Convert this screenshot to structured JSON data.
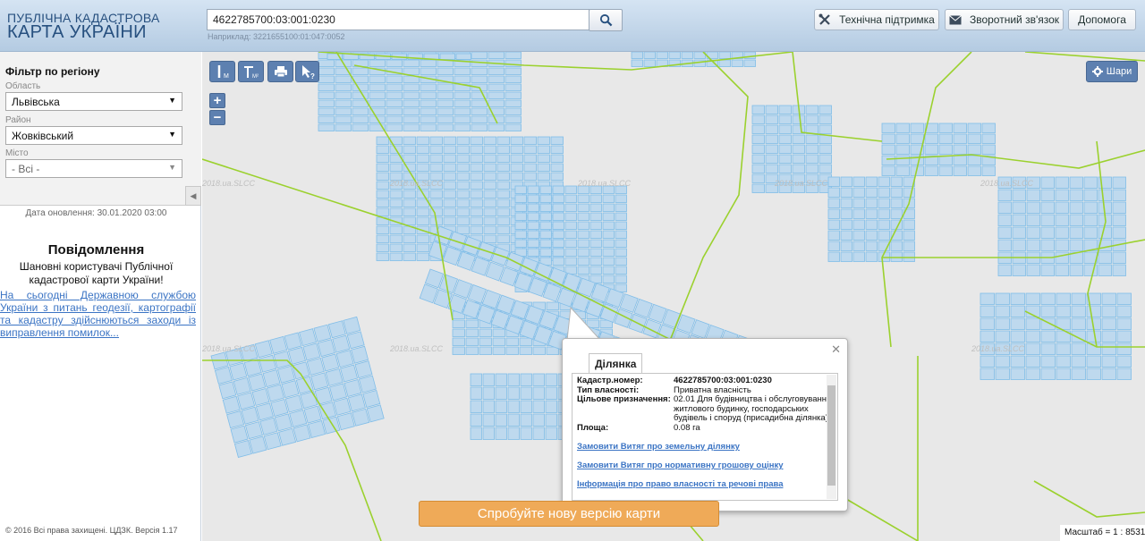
{
  "header": {
    "logo_line1": "ПУБЛІЧНА КАДАСТРОВА",
    "logo_line2": "КАРТА УКРАЇНИ",
    "search_value": "4622785700:03:001:0230",
    "search_example": "Наприклад: 3221655100:01:047:0052",
    "buttons": {
      "support": "Технічна підтримка",
      "feedback": "Зворотний зв'язок",
      "help": "Допомога"
    }
  },
  "sidebar": {
    "filter_title": "Фільтр по регіону",
    "oblast_label": "Область",
    "oblast_value": "Львівська",
    "rayon_label": "Район",
    "rayon_value": "Жовківський",
    "city_label": "Місто",
    "city_value": "- Всі -",
    "updated": "Дата оновлення: 30.01.2020 03:00",
    "notice_title": "Повідомлення",
    "notice_body": "Шановні користувачі Публічної кадастрової карти України!",
    "notice_link": "На сьогодні Державною службою України з питань геодезії, картографії та кадастру здійснюються заходи із виправлення помилок...",
    "copyright": "© 2016 Всі права захищені. ЦДЗК. Версія 1.17"
  },
  "map": {
    "tools": [
      "M",
      "M²"
    ],
    "zoom_in": "+",
    "zoom_out": "−",
    "layers_button": "Шари",
    "watermark": "2018.ua.SLCC",
    "scale": "Масштаб = 1 : 8531",
    "new_version_button": "Спробуйте нову версію карти",
    "colors": {
      "parcel_fill": "#bed9ee",
      "parcel_stroke": "#80bde8",
      "boundary": "#9bd12e",
      "background": "#e8e8e8"
    }
  },
  "popup": {
    "tab": "Ділянка",
    "fields": [
      {
        "label": "Кадастр.номер:",
        "value": "4622785700:03:001:0230"
      },
      {
        "label": "Тип власності:",
        "value": "Приватна власність"
      },
      {
        "label": "Цільове призначення:",
        "value": "02.01 Для будівництва і обслуговування житлового будинку, господарських будівель і споруд (присадибна ділянка)"
      },
      {
        "label": "Площа:",
        "value": "0.08 га"
      }
    ],
    "links": [
      "Замовити Витяг про земельну ділянку",
      "Замовити Витяг про нормативну грошову оцінку",
      "Інформація про право власності та речові права"
    ]
  }
}
